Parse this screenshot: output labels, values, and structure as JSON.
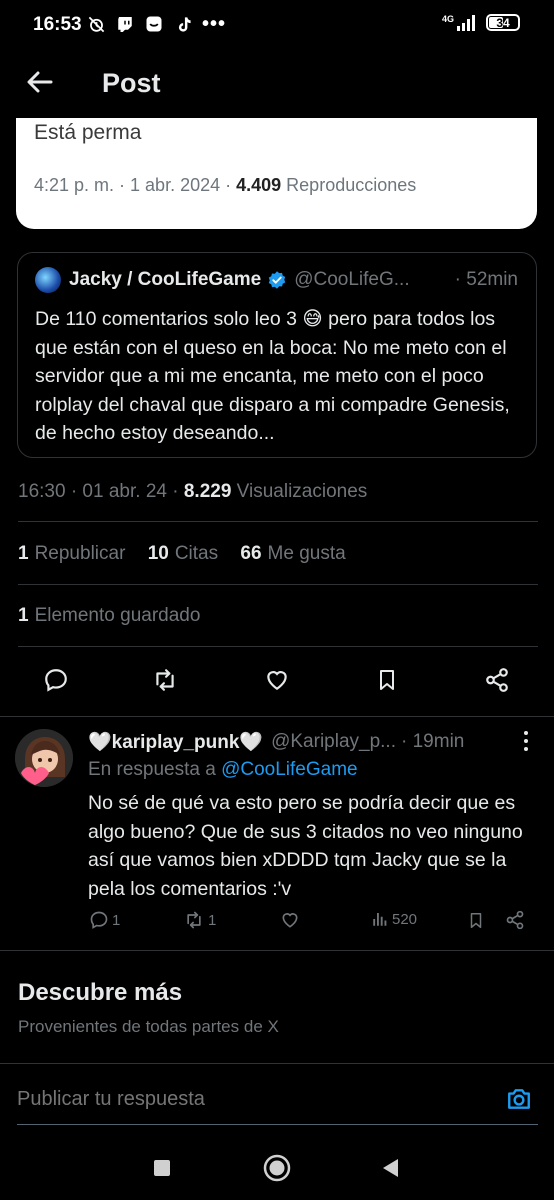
{
  "status_bar": {
    "time": "16:53",
    "network": "4G",
    "battery": "34",
    "more": "•••",
    "icons": [
      "alarm-off-icon",
      "twitch-icon",
      "app-icon",
      "tiktok-icon",
      "signal-icon",
      "battery-icon"
    ]
  },
  "header": {
    "back_icon": "arrow-left-icon",
    "title": "Post"
  },
  "media_card": {
    "text": "Está perma",
    "time": "4:21 p. m. · 1 abr. 2024 · ",
    "views": "4.409",
    "views_label": " Reproducciones"
  },
  "quoted_post": {
    "name": "Jacky / CooLifeGame",
    "handle": "@CooLifeG...",
    "time": "· 52min",
    "body": "De 110 comentarios solo leo 3 😅 pero para todos los que están con el queso en la boca: No me meto con el servidor que a mi me encanta, me meto con el poco rolplay del chaval que disparo a mi compadre Genesis, de hecho estoy deseando...",
    "verified_color": "#1d9bf0"
  },
  "post_meta": {
    "timestamp": "16:30 · 01 abr. 24 · ",
    "views": "8.229",
    "views_label": " Visualizaciones"
  },
  "stats": {
    "reposts_count": "1",
    "reposts_label": "Republicar",
    "quotes_count": "10",
    "quotes_label": "Citas",
    "likes_count": "66",
    "likes_label": "Me gusta",
    "saved_count": "1",
    "saved_label": "Elemento guardado"
  },
  "actions": [
    "reply-icon",
    "repost-icon",
    "like-icon",
    "bookmark-icon",
    "share-icon"
  ],
  "reply": {
    "name": "🤍kariplay_punk🤍",
    "handle": "@Kariplay_p...",
    "time": "· 19min",
    "replying_prefix": "En respuesta a ",
    "replying_to": "@CooLifeGame",
    "body": "No sé de qué va esto pero se podría decir que es algo bueno? Que de sus 3 citados no veo ninguno así que vamos bien xDDDD tqm Jacky que se la pela los comentarios :'v",
    "reply_count": "1",
    "repost_count": "1",
    "views_count": "520"
  },
  "discover": {
    "title": "Descubre más",
    "subtitle": "Provenientes de todas partes de X"
  },
  "compose": {
    "placeholder": "Publicar tu respuesta"
  },
  "colors": {
    "accent": "#1d9bf0",
    "background": "#000000",
    "muted": "#71767b",
    "text": "#e7e9ea"
  }
}
